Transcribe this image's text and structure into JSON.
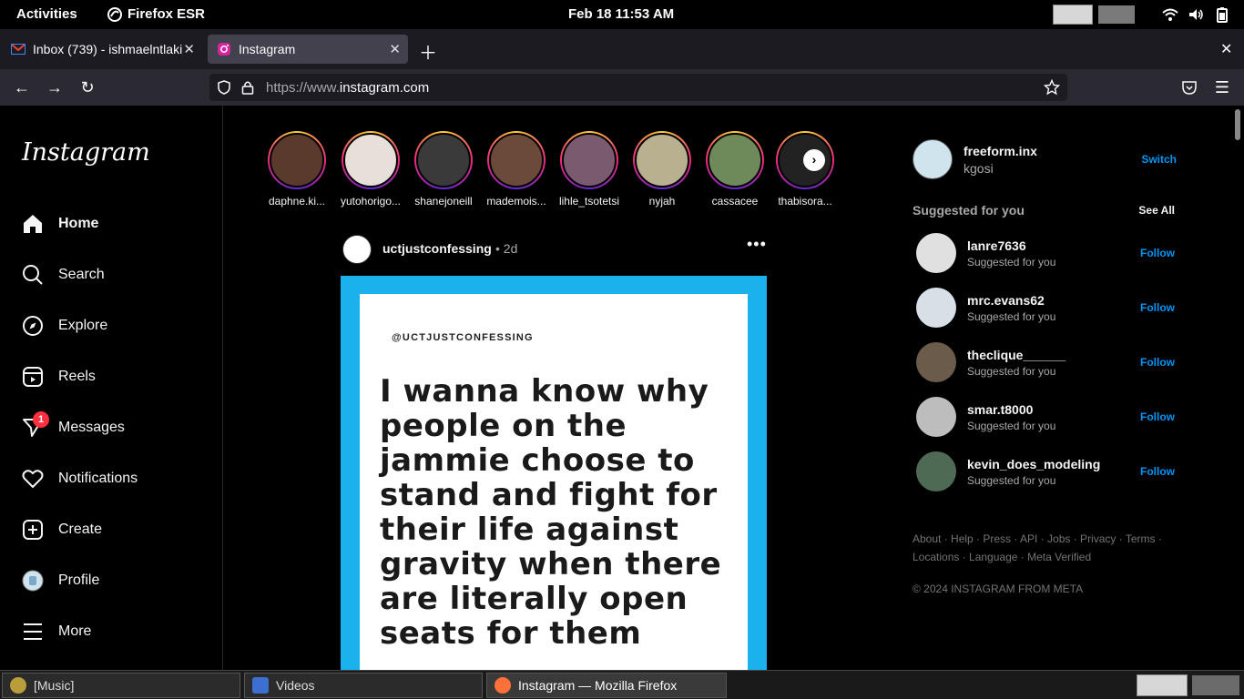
{
  "gnome": {
    "activities": "Activities",
    "app_name": "Firefox ESR",
    "clock": "Feb 18  11:53 AM"
  },
  "browser": {
    "tabs": [
      {
        "label": "Inbox (739) - ishmaelntlaki"
      },
      {
        "label": "Instagram"
      }
    ],
    "url_scheme": "https://www.",
    "url_host": "instagram.com"
  },
  "sidebar": {
    "logo": "Instagram",
    "items": [
      {
        "label": "Home"
      },
      {
        "label": "Search"
      },
      {
        "label": "Explore"
      },
      {
        "label": "Reels"
      },
      {
        "label": "Messages",
        "badge": "1"
      },
      {
        "label": "Notifications"
      },
      {
        "label": "Create"
      },
      {
        "label": "Profile"
      },
      {
        "label": "More"
      }
    ]
  },
  "stories": [
    {
      "name": "daphne.ki..."
    },
    {
      "name": "yutohorigo..."
    },
    {
      "name": "shanejoneill"
    },
    {
      "name": "mademois..."
    },
    {
      "name": "lihle_tsotetsi"
    },
    {
      "name": "nyjah"
    },
    {
      "name": "cassacee"
    },
    {
      "name": "thabisora..."
    }
  ],
  "post": {
    "username": "uctjustconfessing",
    "time": "• 2d",
    "handle": "@UCTJUSTCONFESSING",
    "text_lines": [
      "I wanna know why",
      "people on the",
      "jammie choose to",
      "stand and fight for",
      "their life against",
      "gravity when there",
      "are literally open",
      "seats for them"
    ]
  },
  "right_rail": {
    "me_username": "freeform.inx",
    "me_name": "kgosi",
    "switch": "Switch",
    "suggested_title": "Suggested for you",
    "see_all": "See All",
    "suggestions": [
      {
        "username": "lanre7636",
        "sub": "Suggested for you",
        "action": "Follow"
      },
      {
        "username": "mrc.evans62",
        "sub": "Suggested for you",
        "action": "Follow"
      },
      {
        "username": "theclique______",
        "sub": "Suggested for you",
        "action": "Follow"
      },
      {
        "username": "smar.t8000",
        "sub": "Suggested for you",
        "action": "Follow"
      },
      {
        "username": "kevin_does_modeling",
        "sub": "Suggested for you",
        "action": "Follow"
      }
    ],
    "footer_line1": "About · Help · Press · API · Jobs · Privacy · Terms ·",
    "footer_line2": "Locations · Language · Meta Verified",
    "copyright": "© 2024 INSTAGRAM FROM META"
  },
  "taskbar": {
    "items": [
      {
        "label": "[Music]"
      },
      {
        "label": "Videos"
      },
      {
        "label": "Instagram — Mozilla Firefox"
      }
    ]
  }
}
